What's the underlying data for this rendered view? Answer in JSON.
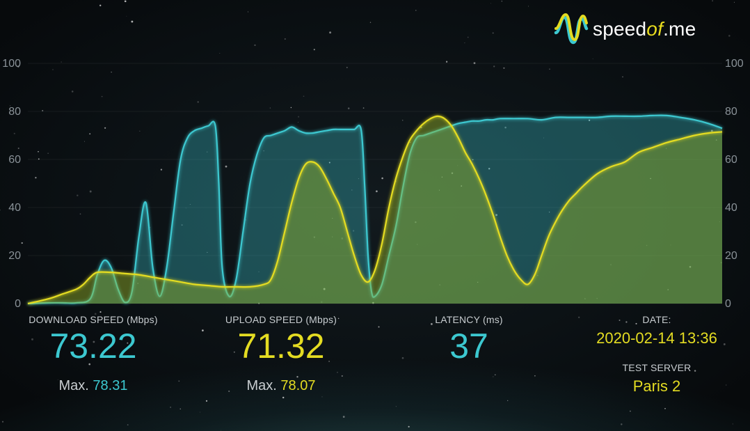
{
  "logo": {
    "prefix": "speed",
    "highlight": "of",
    "suffix": ".me",
    "icon": "waveform-logo-icon"
  },
  "colors": {
    "download": "#3cc8d0",
    "upload": "#e4dc22",
    "label": "#c8cdd0",
    "axis": "#8a9298"
  },
  "stats": {
    "download": {
      "label": "DOWNLOAD SPEED (Mbps)",
      "value": "73.22",
      "max_label": "Max.",
      "max_value": "78.31"
    },
    "upload": {
      "label": "UPLOAD SPEED (Mbps)",
      "value": "71.32",
      "max_label": "Max.",
      "max_value": "78.07"
    },
    "latency": {
      "label": "LATENCY (ms)",
      "value": "37"
    },
    "date": {
      "label": "DATE:",
      "value": "2020-02-14 13:36"
    },
    "server": {
      "label": "TEST SERVER",
      "value": "Paris 2"
    }
  },
  "chart_data": {
    "type": "area",
    "ylim": [
      0,
      100
    ],
    "xlim": [
      0,
      100
    ],
    "yticks": [
      0,
      20,
      40,
      60,
      80,
      100
    ],
    "grid": true,
    "series": [
      {
        "key": "download",
        "x": [
          0,
          3,
          5,
          7,
          9,
          10,
          11,
          12,
          13,
          14,
          15,
          16,
          17,
          18,
          19,
          20,
          21,
          22,
          23,
          24,
          25,
          26,
          27,
          27.5,
          28,
          29,
          30,
          31,
          32,
          33,
          34,
          35,
          36,
          37,
          38,
          39,
          40,
          41,
          42,
          43,
          44,
          45,
          46,
          47,
          48,
          48.5,
          49,
          49.5,
          50,
          51,
          52,
          53,
          54,
          55,
          56,
          57,
          58,
          59,
          60,
          61,
          62,
          63,
          64,
          65,
          66,
          67,
          68,
          70,
          72,
          74,
          76,
          78,
          80,
          82,
          84,
          86,
          88,
          90,
          92,
          94,
          96,
          98,
          100
        ],
        "y": [
          0,
          0.3,
          0.3,
          0.3,
          2,
          12,
          18,
          15,
          6,
          0.5,
          5,
          28,
          42,
          15,
          3,
          15,
          38,
          60,
          69,
          72,
          73,
          74,
          74,
          50,
          15,
          3,
          10,
          30,
          50,
          62,
          69,
          70,
          71,
          72,
          73.5,
          72,
          71,
          71,
          71.5,
          72,
          72.5,
          72.5,
          72.5,
          72.5,
          72.5,
          50,
          20,
          5,
          3,
          8,
          20,
          32,
          48,
          62,
          69,
          70,
          71,
          72,
          73,
          74,
          75,
          75.5,
          76,
          76,
          76.5,
          76.5,
          77,
          77,
          77,
          76.5,
          77.5,
          77.5,
          77.5,
          77.5,
          78,
          78,
          78,
          78.3,
          78.3,
          77.5,
          76.5,
          75,
          73
        ]
      },
      {
        "key": "upload",
        "x": [
          0,
          3,
          5,
          7,
          8,
          9,
          10,
          12,
          14,
          16,
          18,
          20,
          22,
          24,
          26,
          28,
          30,
          32,
          34,
          35,
          36,
          37,
          38,
          39,
          40,
          41,
          42,
          43,
          44,
          45,
          46,
          47,
          48,
          49,
          50,
          51,
          52,
          53,
          54,
          55,
          56,
          57,
          58,
          59,
          60,
          61,
          62,
          63,
          64,
          65,
          66,
          67,
          68,
          69,
          70,
          71,
          72,
          73,
          74,
          75,
          76,
          77,
          78,
          79,
          80,
          82,
          84,
          86,
          88,
          90,
          92,
          94,
          96,
          98,
          100
        ],
        "y": [
          0,
          2,
          4,
          6,
          8,
          11,
          13,
          13,
          12.5,
          12,
          11,
          10,
          9,
          8,
          7.5,
          7,
          7,
          7,
          8,
          10,
          18,
          30,
          42,
          52,
          58,
          59,
          57,
          52,
          46,
          40,
          30,
          20,
          12,
          9,
          14,
          25,
          40,
          52,
          61,
          68,
          72,
          75,
          77,
          78,
          77,
          74,
          69,
          63,
          58,
          52,
          45,
          37,
          28,
          20,
          14,
          10,
          8,
          12,
          20,
          28,
          34,
          39,
          43,
          46,
          49,
          54,
          57,
          59,
          63,
          65,
          67,
          68.5,
          70,
          71,
          71.5
        ]
      }
    ]
  }
}
